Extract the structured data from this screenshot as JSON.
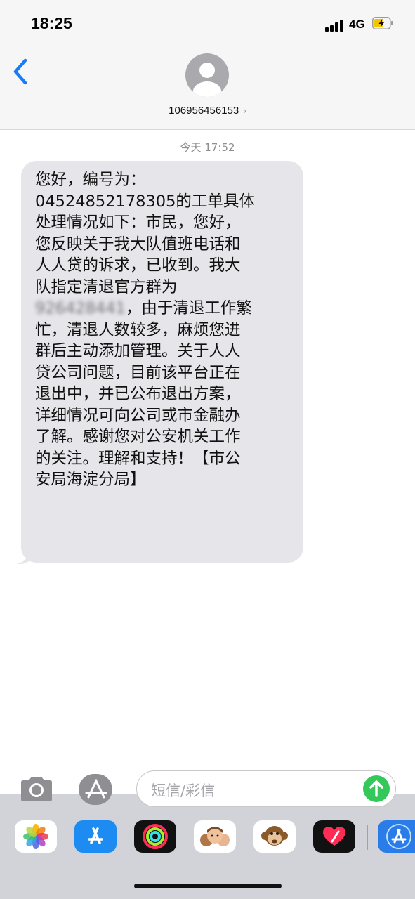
{
  "status_bar": {
    "time": "18:25",
    "network": "4G"
  },
  "header": {
    "contact": "106956456153",
    "chevron": "›"
  },
  "conversation": {
    "timestamp": "今天  17:52",
    "message_lines": [
      "您好，编号为：",
      "04524852178305的工单具体",
      "处理情况如下：市民，您好，",
      "您反映关于我大队值班电话和",
      "人人贷的诉求，已收到。我大",
      "队指定清退官方群为",
      "，由于清退工作繁",
      "忙，清退人数较多，麻烦您进",
      "群后主动添加管理。关于人人",
      "贷公司问题，目前该平台正在",
      "退出中，并已公布退出方案，",
      "详细情况可向公司或市金融办",
      "了解。感谢您对公安机关工作",
      "的关注。理解和支持！【市公",
      "安局海淀分局】"
    ],
    "blurred_number": "926428441"
  },
  "input": {
    "placeholder": "短信/彩信"
  },
  "colors": {
    "bubble": "#e5e5ea",
    "accent": "#1a7cf5",
    "send": "#34c759",
    "drawer": "#d1d3d9"
  },
  "icons": [
    "back-chevron-icon",
    "contact-avatar-icon",
    "camera-icon",
    "app-store-icon",
    "send-arrow-icon",
    "photos-app-icon",
    "app-store-app-icon",
    "activity-app-icon",
    "memoji-app-icon",
    "animoji-monkey-app-icon",
    "digital-touch-app-icon",
    "app-store-more-icon"
  ]
}
